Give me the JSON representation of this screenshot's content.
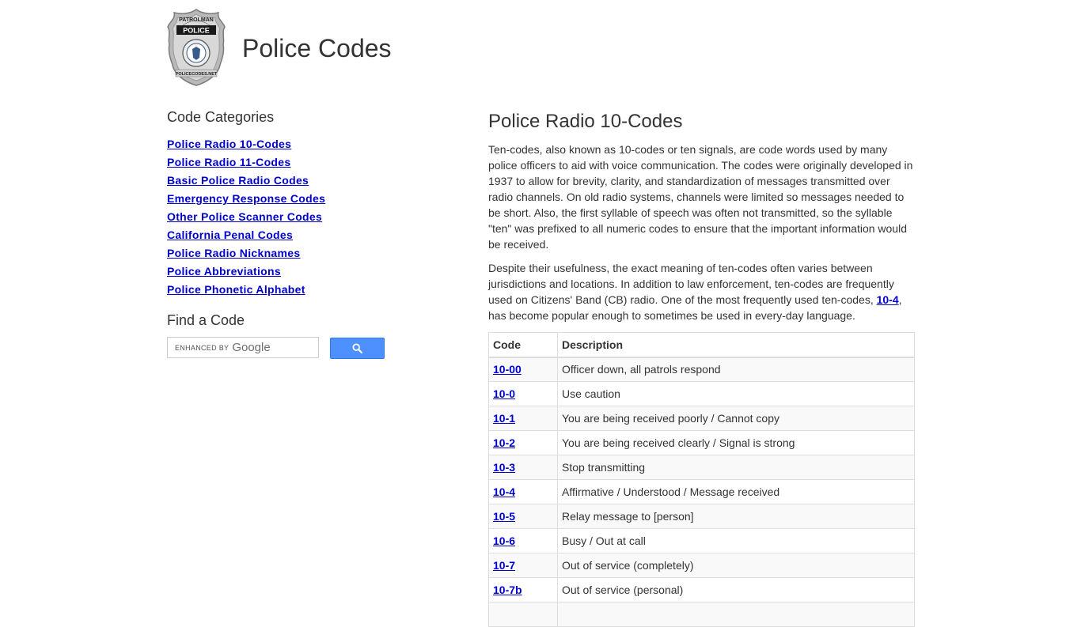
{
  "site": {
    "title": "Police Codes",
    "badge": {
      "top_text": "PATROLMAN",
      "banner_text": "POLICE",
      "bottom_text": "POLICECODES.NET"
    }
  },
  "sidebar": {
    "categories_heading": "Code Categories",
    "categories": [
      "Police Radio 10-Codes",
      "Police Radio 11-Codes",
      "Basic Police Radio Codes",
      "Emergency Response Codes",
      "Other Police Scanner Codes",
      "California Penal Codes",
      "Police Radio Nicknames",
      "Police Abbreviations",
      "Police Phonetic Alphabet"
    ],
    "find_heading": "Find a Code",
    "search": {
      "enhanced_label": "ENHANCED BY",
      "google_label": "Google",
      "button_icon": "search-icon"
    }
  },
  "main": {
    "heading": "Police Radio 10-Codes",
    "paragraph1": "Ten-codes, also known as 10-codes or ten signals, are code words used by many police officers to aid with voice communication. The codes were originally developed in 1937 to allow for brevity, clarity, and standardization of messages transmitted over radio channels. On old radio systems, channels were limited so messages needed to be short. Also, the first syllable of speech was often not transmitted, so the syllable \"ten\" was prefixed to all numeric codes to ensure that the important information would be received.",
    "paragraph2_before": "Despite their usefulness, the exact meaning of ten-codes often varies between jurisdictions and locations. In addition to law enforcement, ten-codes are frequently used on Citizens' Band (CB) radio. One of the most frequently used ten-codes, ",
    "paragraph2_link": "10-4",
    "paragraph2_after": ", has become popular enough to sometimes be used in every-day language.",
    "table": {
      "headers": [
        "Code",
        "Description"
      ],
      "rows": [
        {
          "code": "10-00",
          "description": "Officer down, all patrols respond"
        },
        {
          "code": "10-0",
          "description": "Use caution"
        },
        {
          "code": "10-1",
          "description": "You are being received poorly / Cannot copy"
        },
        {
          "code": "10-2",
          "description": "You are being received clearly / Signal is strong"
        },
        {
          "code": "10-3",
          "description": "Stop transmitting"
        },
        {
          "code": "10-4",
          "description": "Affirmative / Understood / Message received"
        },
        {
          "code": "10-5",
          "description": "Relay message to [person]"
        },
        {
          "code": "10-6",
          "description": "Busy / Out at call"
        },
        {
          "code": "10-7",
          "description": "Out of service (completely)"
        },
        {
          "code": "10-7b",
          "description": "Out of service (personal)"
        },
        {
          "code": "",
          "description": ""
        }
      ]
    }
  },
  "colors": {
    "link": "#0000cc",
    "text": "#333333",
    "button": "#4d90fe",
    "row_stripe": "#f9f9f9",
    "border": "#dddddd"
  }
}
